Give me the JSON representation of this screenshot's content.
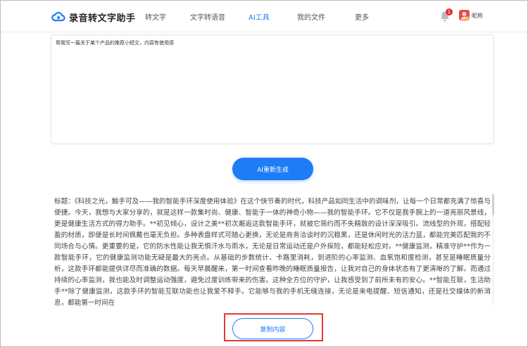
{
  "app": {
    "title": "录音转文字助手"
  },
  "nav": {
    "items": [
      {
        "label": "转文字"
      },
      {
        "label": "文字转语音"
      },
      {
        "label": "AI工具"
      },
      {
        "label": "我的文件"
      },
      {
        "label": "更多"
      }
    ],
    "active": "AI工具"
  },
  "user": {
    "notification_count": "1",
    "nickname": "昵称"
  },
  "prompt": {
    "value": "帮我写一篇关于某个产品的推荐小短文，内容有使用感"
  },
  "actions": {
    "regenerate_label": "AI重新生成",
    "copy_label": "复制内容"
  },
  "result": {
    "text": "标题：《科技之光，触手可及——我的智能手环深度使用体验》在这个快节奏的时代，科技产品如同生活中的调味剂，让每一个日常都充满了惊喜与便捷。今天，我想与大家分享的，就是这样一款集时尚、健康、智能于一体的神奇小物——我的智能手环。它不仅是我手腕上的一道亮丽风景线，更是健康生活方式的得力助手。**初见倾心，设计之美**初次邂逅这款智能手环，就被它简约而不失精致的设计深深吸引。流线型的外观，搭配轻盈的材质，即便是长时间佩戴也毫无负担。多种表盘样式可随心更换，无论是商务洽谈时的沉稳黑，还是休闲时光的活力蓝，都能完美匹配我的不同场合与心情。更重要的是，它的防水性能让我无惧汗水与雨水，无论是日常运动还是户外探险，都能轻松应对。**健康监测，精准守护**作为一款智能手环，它的健康监测功能无疑是最大的亮点。从基础的步数统计、卡路里消耗，到进阶的心率监测、血氧饱和度检测，甚至是睡眠质量分析，这款手环都能提供详尽而准确的数据。每天早晨醒来，第一时间查看昨晚的睡眠质量报告，让我对自己的身体状态有了更清晰的了解。而通过持续的心率监测，我也能及时调整运动强度，避免过度训练带来的伤害。这种全方位的守护，让我感受到了前所未有的安心。**智能互联，生活助手**除了健康监测，这款手环的智能互联功能也让我爱不释手。它能够与我的手机无缝连接，无论是来电提醒、短信通知，还是社交媒体的新消息，都能第一时间在"
  },
  "colors": {
    "accent": "#1e7cf6",
    "highlight": "#e53935",
    "badge": "#e62e2e"
  },
  "icons": {
    "logo": "cloud-logo-icon",
    "bell": "bell-icon",
    "avatar": "avatar-icon"
  }
}
